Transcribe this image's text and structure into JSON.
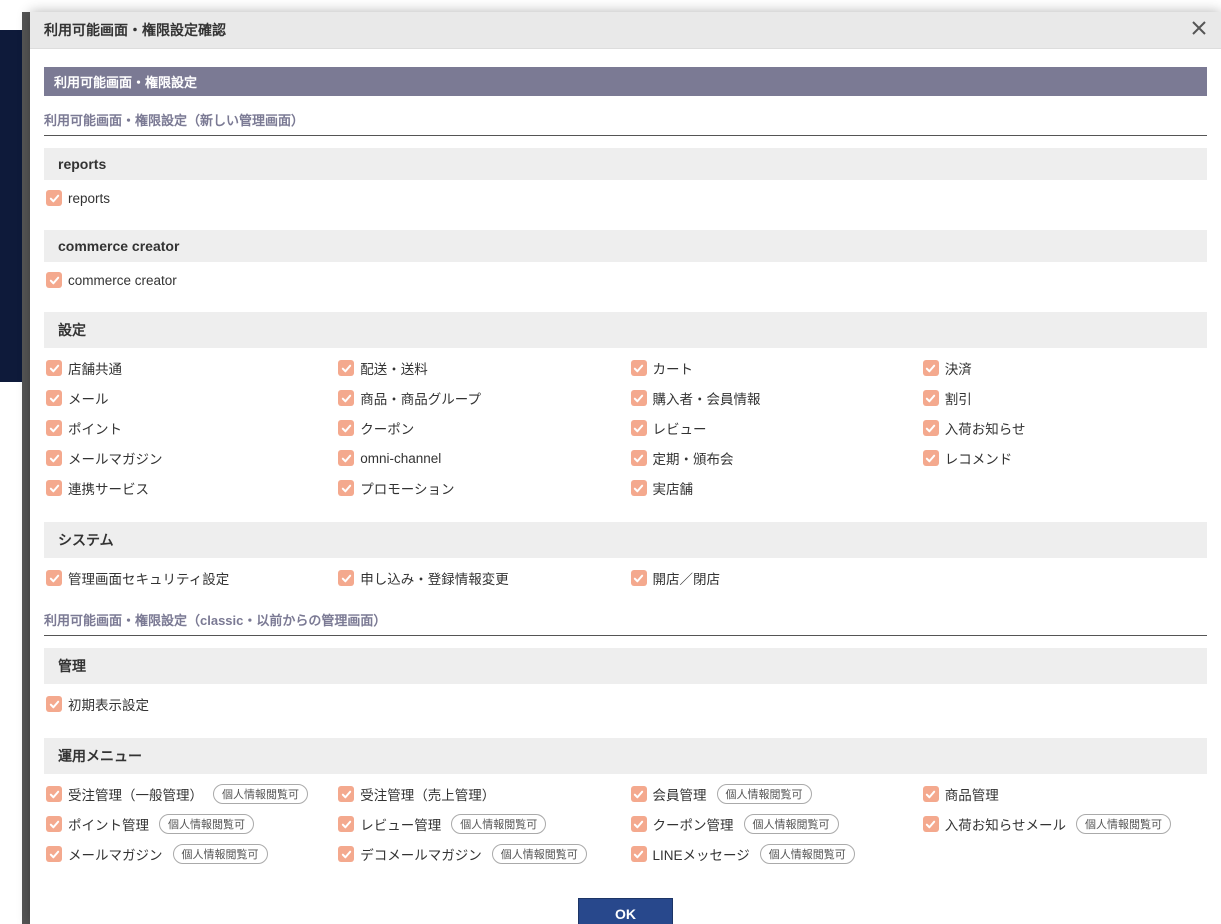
{
  "modal": {
    "title": "利用可能画面・権限設定確認",
    "band": "利用可能画面・権限設定",
    "section_new": "利用可能画面・権限設定（新しい管理画面）",
    "section_classic": "利用可能画面・権限設定（classic・以前からの管理画面）",
    "ok": "OK"
  },
  "badge": "個人情報閲覧可",
  "groups_new": [
    {
      "heading": "reports",
      "items": [
        {
          "label": "reports"
        }
      ]
    },
    {
      "heading": "commerce creator",
      "items": [
        {
          "label": "commerce creator"
        }
      ]
    },
    {
      "heading": "設定",
      "items": [
        {
          "label": "店舗共通"
        },
        {
          "label": "配送・送料"
        },
        {
          "label": "カート"
        },
        {
          "label": "決済"
        },
        {
          "label": "メール"
        },
        {
          "label": "商品・商品グループ"
        },
        {
          "label": "購入者・会員情報"
        },
        {
          "label": "割引"
        },
        {
          "label": "ポイント"
        },
        {
          "label": "クーポン"
        },
        {
          "label": "レビュー"
        },
        {
          "label": "入荷お知らせ"
        },
        {
          "label": "メールマガジン"
        },
        {
          "label": "omni-channel"
        },
        {
          "label": "定期・頒布会"
        },
        {
          "label": "レコメンド"
        },
        {
          "label": "連携サービス"
        },
        {
          "label": "プロモーション"
        },
        {
          "label": "実店舗"
        }
      ]
    },
    {
      "heading": "システム",
      "items": [
        {
          "label": "管理画面セキュリティ設定"
        },
        {
          "label": "申し込み・登録情報変更"
        },
        {
          "label": "開店／閉店"
        }
      ]
    }
  ],
  "groups_classic": [
    {
      "heading": "管理",
      "items": [
        {
          "label": "初期表示設定"
        }
      ]
    },
    {
      "heading": "運用メニュー",
      "items": [
        {
          "label": "受注管理（一般管理）",
          "badge": true
        },
        {
          "label": "受注管理（売上管理）"
        },
        {
          "label": "会員管理",
          "badge": true
        },
        {
          "label": "商品管理"
        },
        {
          "label": "ポイント管理",
          "badge": true
        },
        {
          "label": "レビュー管理",
          "badge": true
        },
        {
          "label": "クーポン管理",
          "badge": true
        },
        {
          "label": "入荷お知らせメール",
          "badge": true
        },
        {
          "label": "メールマガジン",
          "badge": true
        },
        {
          "label": "デコメールマガジン",
          "badge": true
        },
        {
          "label": "LINEメッセージ",
          "badge": true
        }
      ]
    }
  ]
}
